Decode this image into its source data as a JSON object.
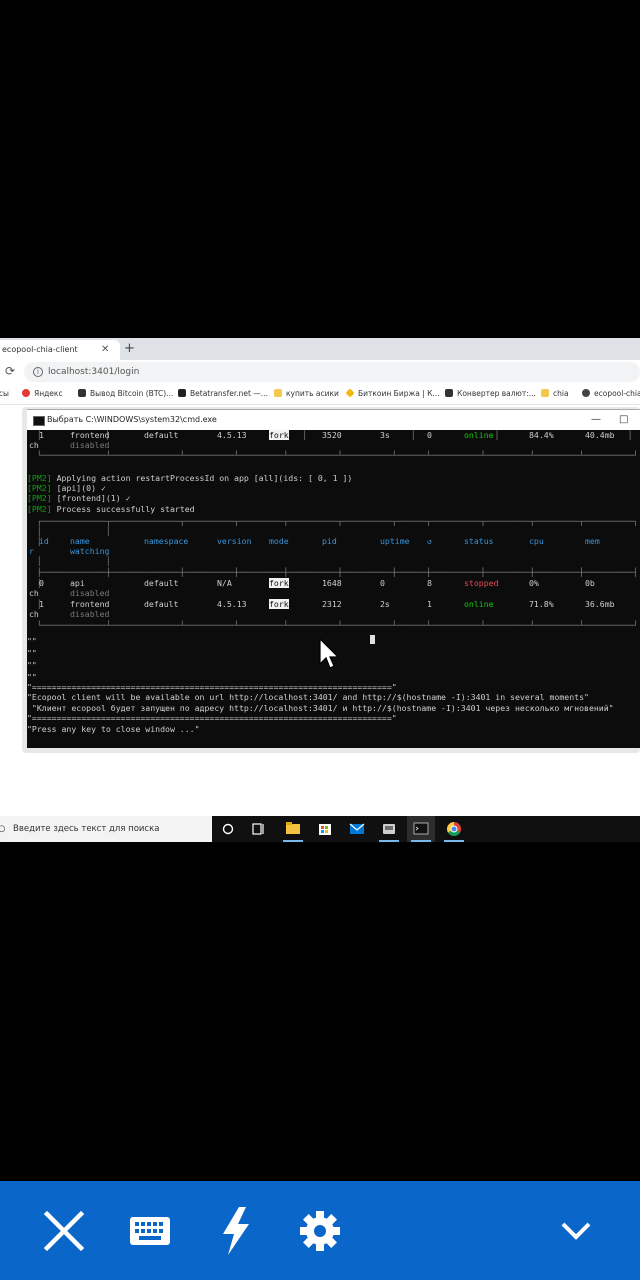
{
  "browser": {
    "tab_title": "ecopool-chia-client",
    "tab_close": "✕",
    "new_tab": "+",
    "url": "localhost:3401/login",
    "bookmarks": [
      {
        "label": "исы",
        "color": "#ffffff"
      },
      {
        "label": "Яндекс",
        "color": "#e53935"
      },
      {
        "label": "Вывод Bitcoin (BTC)...",
        "color": "#333333"
      },
      {
        "label": "Betatransfer.net —...",
        "color": "#222222"
      },
      {
        "label": "купить асики",
        "color": "#f2c94c"
      },
      {
        "label": "Биткоин Биржа | К...",
        "color": "#f0b90b"
      },
      {
        "label": "Конвертер валют:...",
        "color": "#333333"
      },
      {
        "label": "chia",
        "color": "#f2c94c"
      },
      {
        "label": "ecopool-chia-...",
        "color": "#444444"
      }
    ]
  },
  "cmd": {
    "title": "Выбрать C:\\WINDOWS\\system32\\cmd.exe",
    "minimize": "—",
    "maximize": "□",
    "top_row": {
      "id": "1",
      "name": "frontend",
      "watch": "disabled",
      "ns": "default",
      "version": "4.5.13",
      "mode": "fork",
      "pid": "3520",
      "uptime": "3s",
      "restarts": "0",
      "status": "online",
      "cpu": "84.4%",
      "mem": "40.4mb",
      "left": "ch"
    },
    "log": [
      {
        "tag": "[PM2]",
        "text": " Applying action restartProcessId on app [all](ids: [ 0, 1 ])"
      },
      {
        "tag": "[PM2]",
        "text": " [api](0) ✓"
      },
      {
        "tag": "[PM2]",
        "text": " [frontend](1) ✓"
      },
      {
        "tag": "[PM2]",
        "text": " Process successfully started"
      }
    ],
    "headers": {
      "id": "id",
      "name": "name",
      "watching": "watching",
      "namespace": "namespace",
      "version": "version",
      "mode": "mode",
      "pid": "pid",
      "uptime": "uptime",
      "restarts": "↺",
      "status": "status",
      "cpu": "cpu",
      "mem": "mem",
      "left": "r"
    },
    "rows": [
      {
        "left": "ch",
        "id": "0",
        "name": "api",
        "watch": "disabled",
        "ns": "default",
        "version": "N/A",
        "mode": "fork",
        "pid": "1648",
        "uptime": "0",
        "restarts": "8",
        "status": "stopped",
        "cpu": "0%",
        "mem": "0b"
      },
      {
        "left": "ch",
        "id": "1",
        "name": "frontend",
        "watch": "disabled",
        "ns": "default",
        "version": "4.5.13",
        "mode": "fork",
        "pid": "2312",
        "uptime": "2s",
        "restarts": "1",
        "status": "online",
        "cpu": "71.8%",
        "mem": "36.6mb"
      }
    ],
    "quotes": [
      "\"\"",
      "\"\"",
      "\"\"",
      "\"\""
    ],
    "rule": "\"=========================================================================\"",
    "msg_en": "\"Ecopool client will be available on url http://localhost:3401/ and http://$(hostname -I):3401 in several moments\"",
    "msg_ru": " \"Клиент ecopool будет запущен по адресу http://localhost:3401/ и http://$(hostname -I):3401 через несколько мгновений\"",
    "press_key": "\"Press any key to close window ...\""
  },
  "taskbar": {
    "search_placeholder": "Введите здесь текст для поиска",
    "items": [
      "task-view-icon",
      "timeline-icon",
      "file-explorer-icon",
      "store-icon",
      "mail-icon",
      "app-icon",
      "cmd-icon",
      "chrome-icon"
    ]
  },
  "bottom_bar": {
    "buttons": [
      "close-icon",
      "keyboard-icon",
      "lightning-icon",
      "settings-icon",
      "chevron-down-icon"
    ],
    "accent": "#0a66c8"
  }
}
